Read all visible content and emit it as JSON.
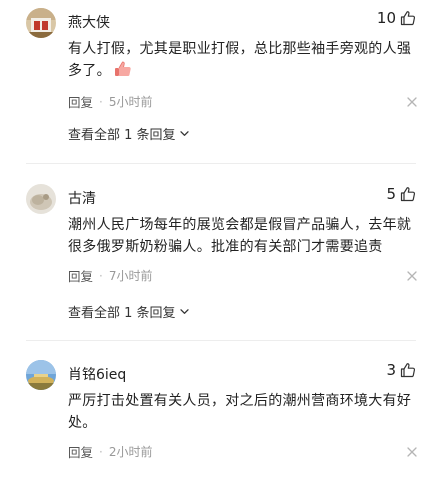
{
  "comments": [
    {
      "username": "燕大侠",
      "likes": "10",
      "content": "有人打假，尤其是职业打假，总比那些袖手旁观的人强多了。",
      "reply_label": "回复",
      "separator": "·",
      "time": "5小时前",
      "view_all": "查看全部 1 条回复"
    },
    {
      "username": "古清",
      "likes": "5",
      "content": "潮州人民广场每年的展览会都是假冒产品骗人，去年就很多俄罗斯奶粉骗人。批准的有关部门才需要追责",
      "reply_label": "回复",
      "separator": "·",
      "time": "7小时前",
      "view_all": "查看全部 1 条回复"
    },
    {
      "username": "肖铭6ieq",
      "likes": "3",
      "content": "严厉打击处置有关人员，对之后的潮州营商环境大有好处。",
      "reply_label": "回复",
      "separator": "·",
      "time": "2小时前"
    }
  ],
  "icons": {
    "like": "thumbs-up-icon",
    "close": "close-icon",
    "expand": "chevron-down-icon"
  }
}
